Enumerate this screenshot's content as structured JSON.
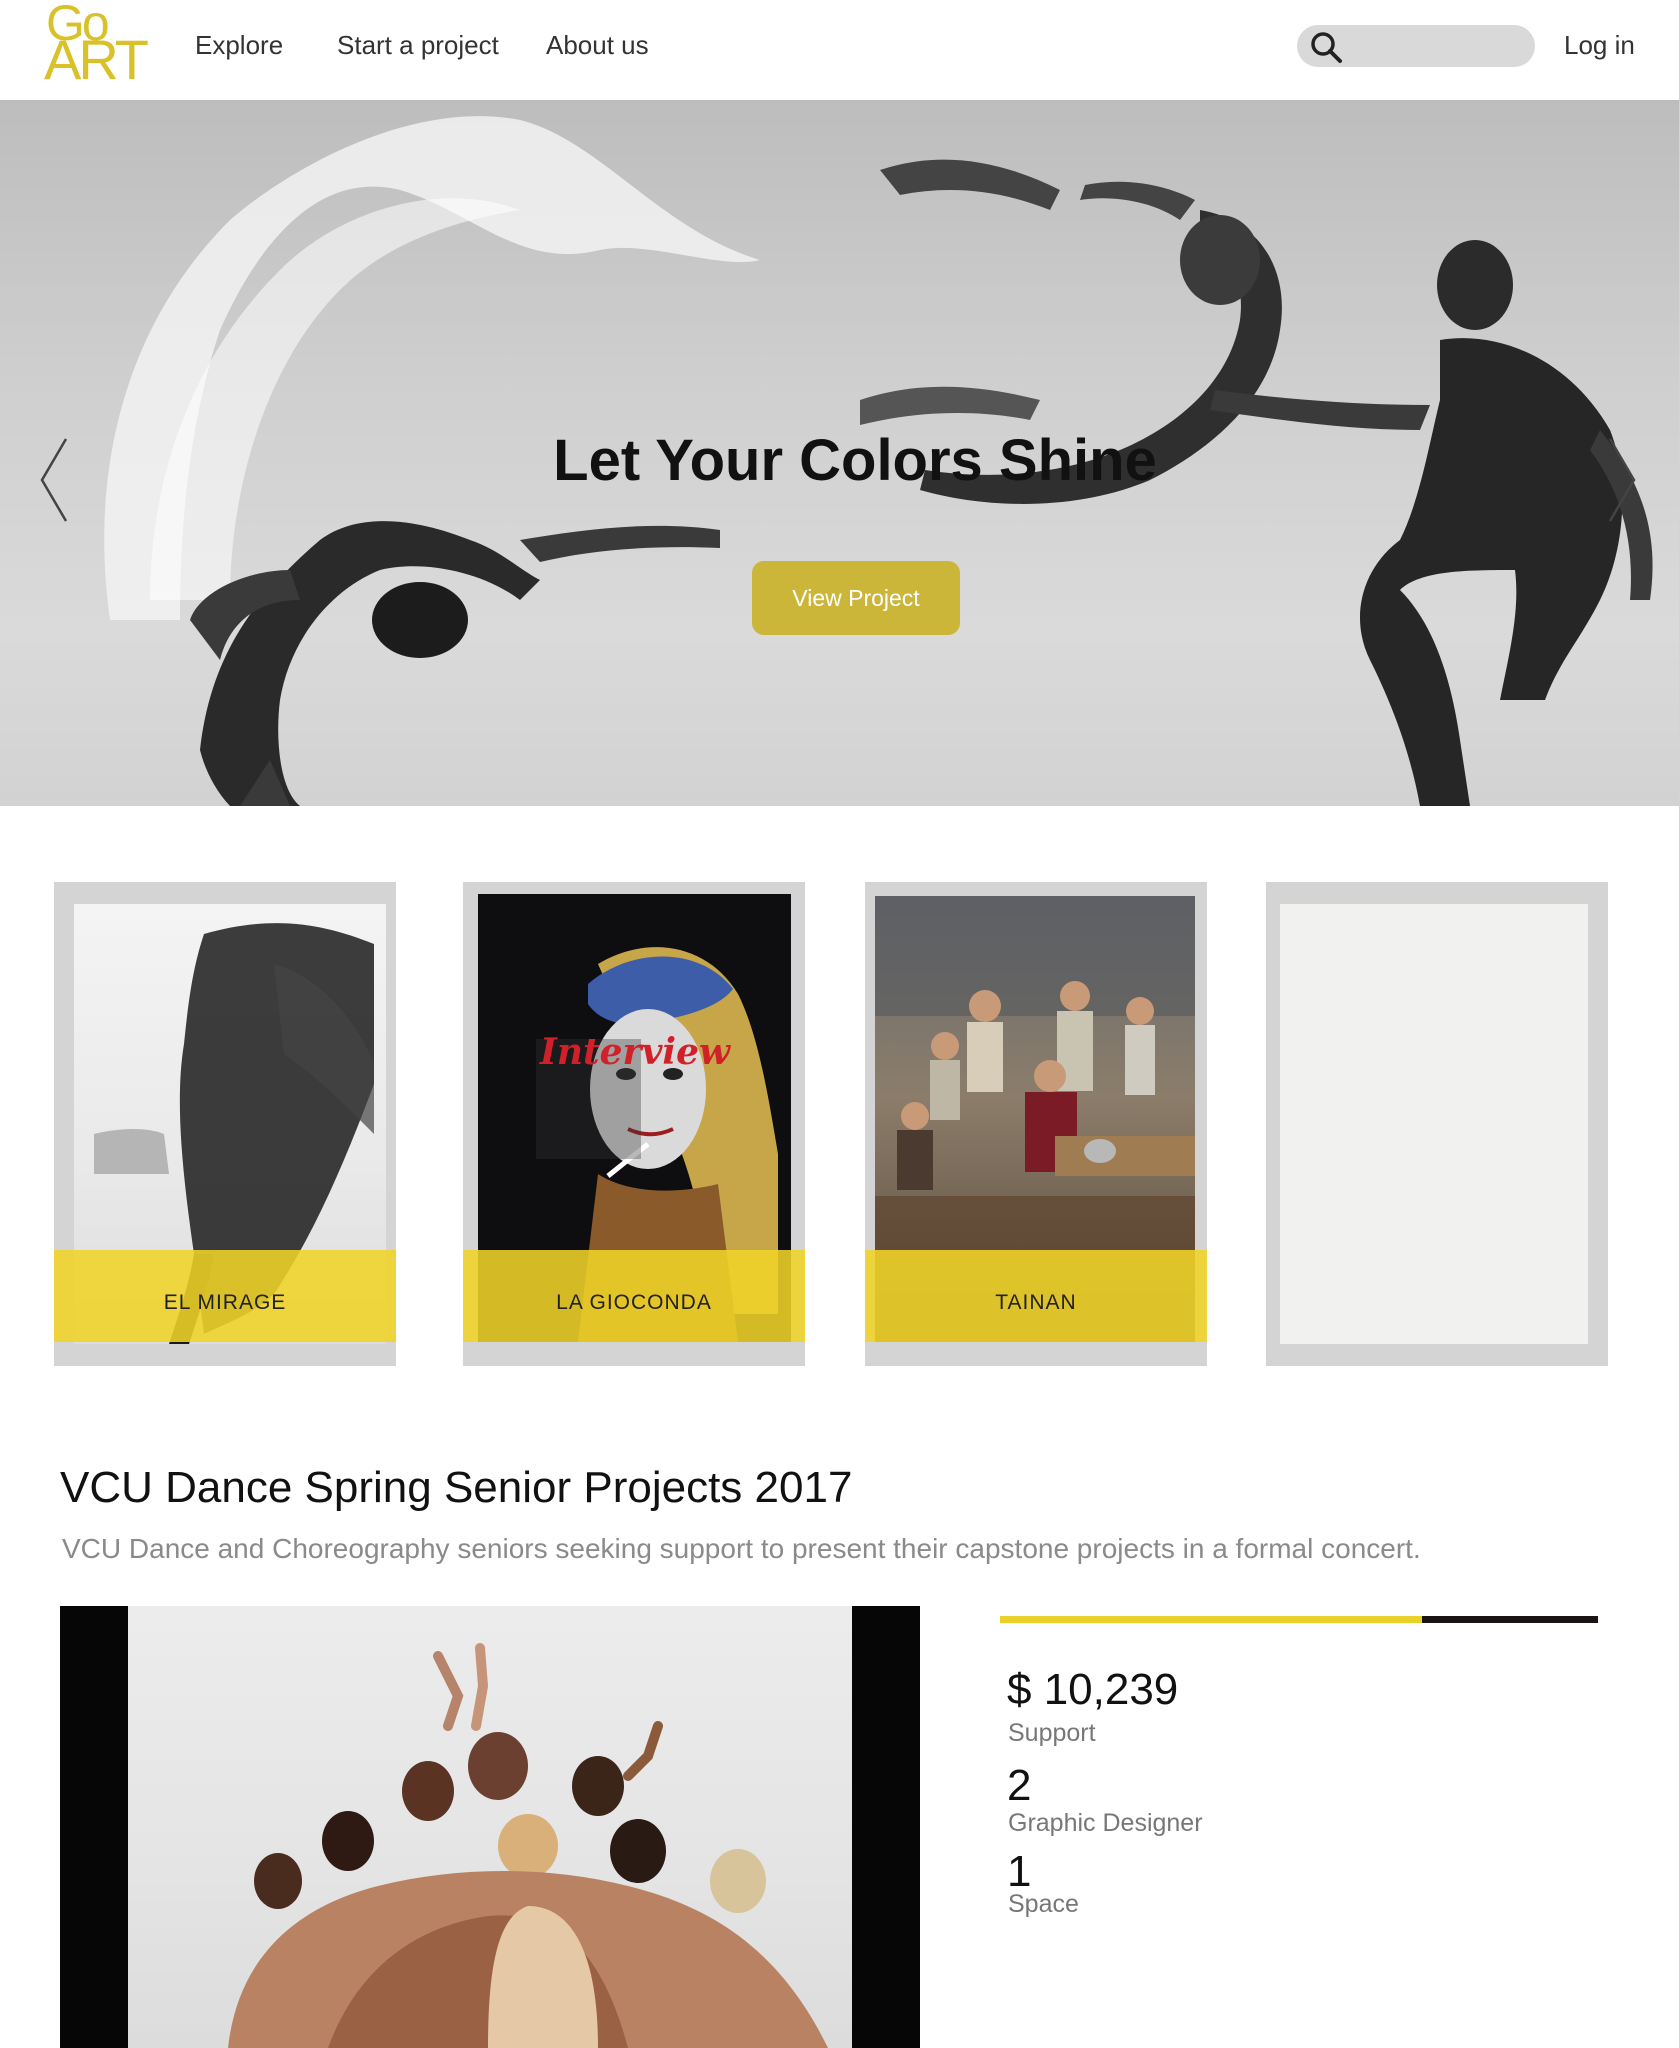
{
  "header": {
    "logo_top": "Go",
    "logo_bottom": "ART",
    "nav": [
      "Explore",
      "Start a project",
      "About us"
    ],
    "search_placeholder": "",
    "login": "Log in"
  },
  "hero": {
    "title": "Let Your Colors Shine",
    "button": "View Project",
    "slides_total": 6,
    "active_slide": 2
  },
  "cards": [
    {
      "label": "EL MIRAGE"
    },
    {
      "label": "LA GIOCONDA",
      "magazine_text": "Interview"
    },
    {
      "label": "TAINAN"
    },
    {
      "label": ""
    }
  ],
  "project": {
    "title": "VCU Dance Spring Senior Projects 2017",
    "description": "VCU Dance and Choreography seniors seeking support to present their capstone projects in a formal concert.",
    "progress_fraction": 0.705,
    "stats": [
      {
        "value": "$ 10,239",
        "label": "Support"
      },
      {
        "value": "2",
        "label": "Graphic Designer"
      },
      {
        "value": "1",
        "label": "Space"
      }
    ]
  },
  "colors": {
    "accent": "#cbb63a",
    "card_label": "#f0d428",
    "progress_fill": "#ead02a",
    "progress_track": "#1a1414"
  }
}
